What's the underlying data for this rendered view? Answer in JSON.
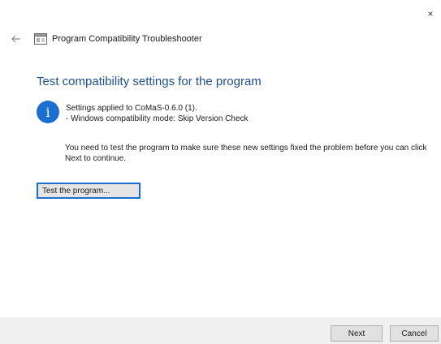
{
  "window": {
    "title": "Program Compatibility Troubleshooter",
    "close_label": "×"
  },
  "content": {
    "heading": "Test compatibility settings for the program",
    "info_line_1": "Settings applied to CoMaS-0.6.0 (1).",
    "info_line_2": "- Windows compatibility mode: Skip Version Check",
    "message": "You need to test the program to make sure these new settings fixed the problem before you can click Next to continue.",
    "test_button_label": "Test the program...",
    "info_icon_glyph": "i"
  },
  "footer": {
    "next_label": "Next",
    "cancel_label": "Cancel"
  },
  "colors": {
    "heading": "#1f4e8c",
    "accent": "#1a6fd1",
    "footer_bg": "#f0f0f0"
  },
  "icons": [
    "back-arrow-icon",
    "troubleshooter-app-icon",
    "info-icon",
    "close-icon"
  ]
}
